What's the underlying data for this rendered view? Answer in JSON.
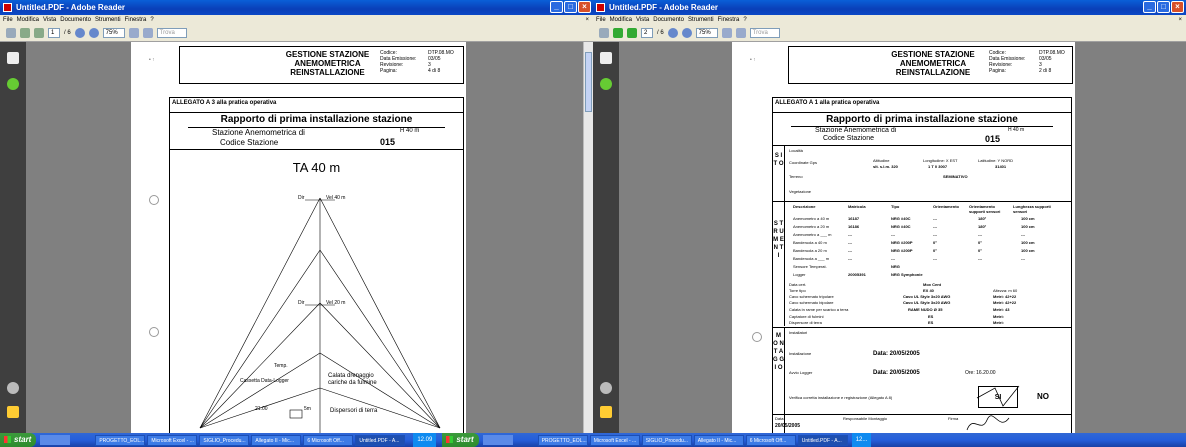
{
  "left_window": {
    "title": "Untitled.PDF - Adobe Reader",
    "menu": [
      "File",
      "Modifica",
      "Vista",
      "Documento",
      "Strumenti",
      "Finestra",
      "?"
    ],
    "page_input": "1",
    "page_total": "/ 6",
    "zoom": "75%",
    "search_placeholder": "Trova",
    "header": {
      "title_line1": "GESTIONE STAZIONE",
      "title_line2": "ANEMOMETRICA",
      "title_line3": "REINSTALLAZIONE",
      "f1": "Codice:",
      "f2": "Data Emissione:",
      "f3": "Revisione:",
      "f4": "Pagina:",
      "v1": "DTP.08.MO",
      "v2": "03/05",
      "v3": "3",
      "v4": "4 di 8"
    },
    "allegato": "ALLEGATO A 3 alla pratica operativa",
    "report_title": "Rapporto di prima installazione stazione",
    "station_label": "Stazione Anemometrica di",
    "station_height": "H 40 m",
    "code_label": "Codice Stazione",
    "code_value": "015",
    "tower_title": "TA 40 m",
    "labels": {
      "dir": "Dir",
      "vel40": "Vel 40 m",
      "vel20": "Vel 20 m",
      "temp": "Temp.",
      "cassetta": "Cassetta Data-Logger",
      "calata1": "Calata drenaggio",
      "calata2": "cariche da fulmine",
      "dispersori": "Dispersori di terra",
      "quota": "21.00",
      "sm": "5m"
    }
  },
  "right_window": {
    "title": "Untitled.PDF - Adobe Reader",
    "menu": [
      "File",
      "Modifica",
      "Vista",
      "Documento",
      "Strumenti",
      "Finestra",
      "?"
    ],
    "page_input": "2",
    "page_total": "/ 6",
    "zoom": "75%",
    "search_placeholder": "Trova",
    "header": {
      "title_line1": "GESTIONE STAZIONE",
      "title_line2": "ANEMOMETRICA",
      "title_line3": "REINSTALLAZIONE",
      "f1": "Codice:",
      "f2": "Data Emissione:",
      "f3": "Revisione:",
      "f4": "Pagina:",
      "v1": "DTP.08.MO",
      "v2": "03/05",
      "v3": "3",
      "v4": "2 di 8"
    },
    "allegato": "ALLEGATO A 1 alla pratica operativa",
    "report_title": "Rapporto di prima installazione stazione",
    "station_label": "Stazione Anemometrica di",
    "station_height": "H 40 m",
    "code_label": "Codice Stazione",
    "code_value": "015",
    "sito": {
      "stripe": "S I T O",
      "localita": "Località",
      "coordinate": "Coordinate Gps",
      "altitudine": "Altitudine",
      "altitudine_val": "slt. s.l.m. 320",
      "long": "Longitudine: X EST",
      "long_val": "1 T 0 3007",
      "lat": "Latitudine: Y NORD",
      "lat_val": "31401",
      "terreno": "Terreno",
      "terreno_val": "SEMINATIVO",
      "vegetazione": "Vegetazione"
    },
    "strumenti": {
      "stripe": "S T R U M E N T I",
      "headers": [
        "Descrizione",
        "Matricola",
        "Tipo",
        "Orientamento",
        "Orientamento supporti sensori",
        "Lunghezza supporti sensori"
      ],
      "rows": [
        [
          "Anemometro a 40 m",
          "16187",
          "NRG #40C",
          "---",
          "180°",
          "100 cm"
        ],
        [
          "Anemometro a 20 m",
          "16186",
          "NRG #40C",
          "---",
          "180°",
          "100 cm"
        ],
        [
          "Anemometro a ___ m",
          "---",
          "---",
          "---",
          "---",
          "---"
        ],
        [
          "Banderuola a 40 m",
          "---",
          "NRG #200P",
          "0°",
          "0°",
          "100 cm"
        ],
        [
          "Banderuola a 20 m",
          "---",
          "NRG #200P",
          "0°",
          "0°",
          "100 cm"
        ],
        [
          "Banderuola a ___ m",
          "---",
          "---",
          "---",
          "---",
          "---"
        ],
        [
          "Sensore Temperat.",
          "",
          "NRG",
          "",
          "",
          ""
        ],
        [
          "Logger",
          "20005391",
          "NRG Symphonie",
          "",
          "",
          ""
        ]
      ],
      "data_cert": "Data cert.",
      "data_cert_val": "Mox Cent",
      "torre_tipo": "Torre tipo",
      "torre_val": "EX 40",
      "altezza": "Altezza: m 60",
      "cavo1": "Cavo schermato tripolare",
      "cavo1_val": "Cavo UL Style 3x20 AWG",
      "metri1": "Metri: 42+22",
      "cavo2": "Cavo schermato bipolare",
      "cavo2_val": "Cavo UL Style 3x20 AWG",
      "metri2": "Metri: 42+22",
      "calata": "Calata in rame per scarico a terra",
      "calata_val": "RAME NUDO Ø 35",
      "metri3": "Metri: 43",
      "captatore": "Captatore di fulmini",
      "captatore_val": "ES",
      "metri4": "Metri:",
      "dispersore": "Dispersore di terra",
      "dispersore_val": "ES",
      "metri5": "Metri:"
    },
    "montaggio": {
      "stripe": "M O N T A G G I O",
      "installatori": "Installatori",
      "installazione": "Installazione",
      "data_inst": "Data: 20/05/2005",
      "avvio": "Avvio Logger",
      "data_avvio": "Data: 20/05/2005",
      "ore": "Ore: 16.20.00",
      "verifica": "Verifica corretta installazione e registrazione (Allegato A 8)",
      "si": "SI",
      "no": "NO",
      "data_foot": "Data:",
      "data_foot_val": "20/05/2005",
      "resp": "Responsabile Montaggio",
      "firma": "Firma"
    }
  },
  "taskbar": {
    "start": "start",
    "tasks": [
      "PROGETTO_EOL...",
      "Microsoft Excel - ...",
      "SIGLIO_Procedu...",
      "Allegato II - Mic...",
      "6 Microsoft Off...",
      "Untitled.PDF - A..."
    ],
    "tasks_right": [
      "PROGETTO_EOL...",
      "Microsoft Excel - ...",
      "SIGLIO_Procedu...",
      "Allegato II - Mic...",
      "6 Microsoft Off...",
      "Untitled.PDF - A..."
    ],
    "clock": "12.09",
    "clock_right": "12..."
  },
  "colors": {
    "titlebar": "#0a3fb8",
    "taskbar": "#245edb",
    "start": "#2e8b2e",
    "viewer_bg": "#808080"
  }
}
